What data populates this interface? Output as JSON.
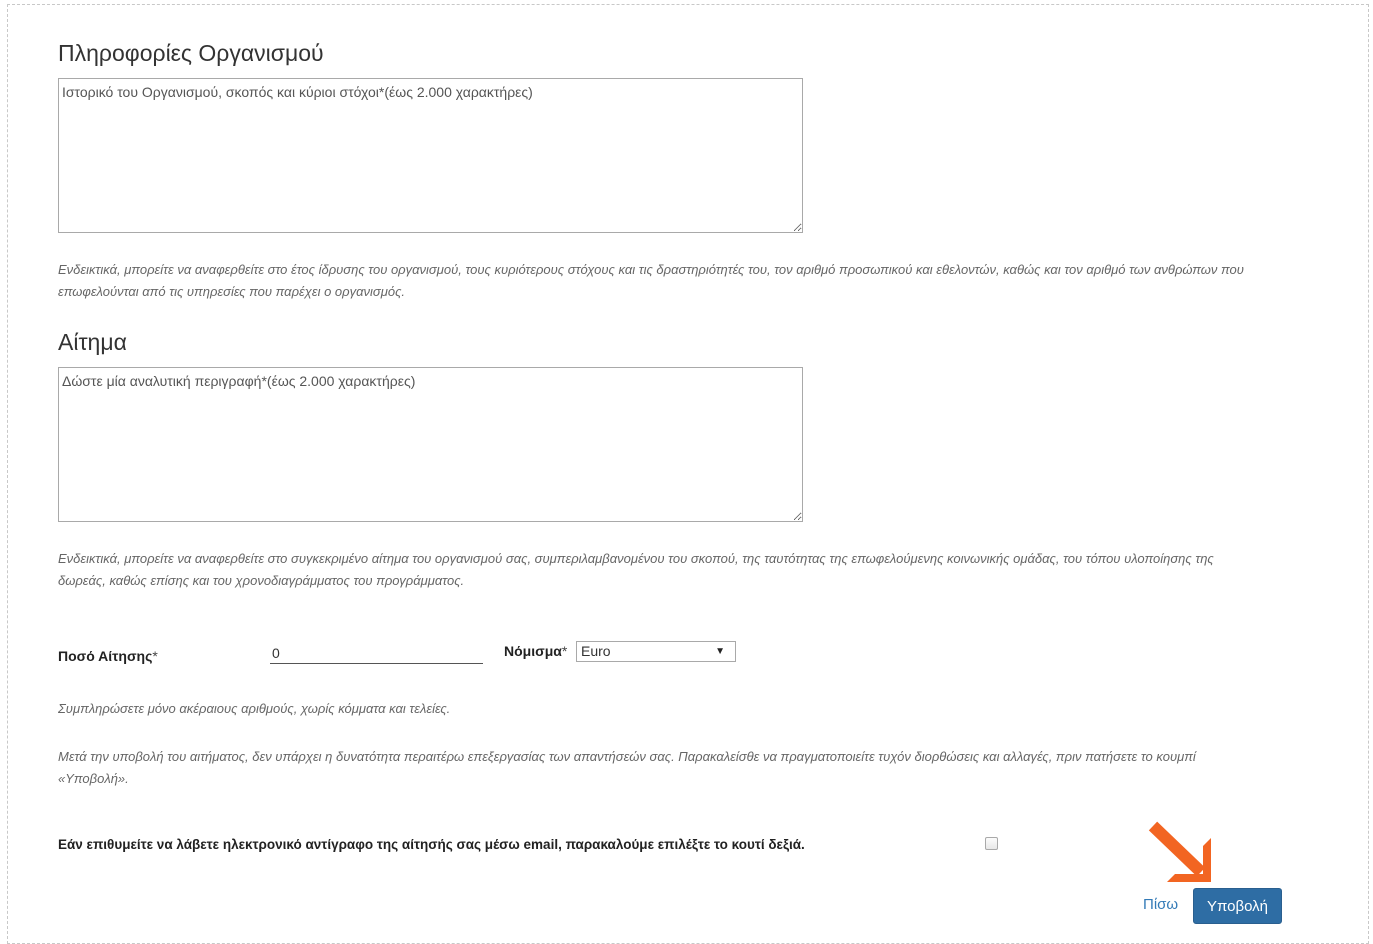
{
  "org_section": {
    "title": "Πληροφορίες Οργανισμού",
    "textarea_placeholder": "Ιστορικό του Οργανισμού, σκοπός και κύριοι στόχοι*(έως 2.000 χαρακτήρες)",
    "hint": "Ενδεικτικά, μπορείτε να αναφερθείτε στο έτος ίδρυσης του οργανισμού, τους κυριότερους στόχους και τις δραστηριότητές του, τον αριθμό προσωπικού και εθελοντών, καθώς και τον αριθμό των ανθρώπων που επωφελούνται από τις υπηρεσίες που παρέχει ο οργανισμός."
  },
  "request_section": {
    "title": "Αίτημα",
    "textarea_placeholder": "Δώστε μία αναλυτική περιγραφή*(έως 2.000 χαρακτήρες)",
    "hint": "Ενδεικτικά, μπορείτε να αναφερθείτε στο συγκεκριμένο αίτημα του οργανισμού σας, συμπεριλαμβανομένου του σκοπού, της ταυτότητας της επωφελούμενης κοινωνικής ομάδας, του τόπου υλοποίησης της δωρεάς, καθώς επίσης και του χρονοδιαγράμματος του προγράμματος."
  },
  "amount": {
    "label": "Ποσό Αίτησης",
    "required_mark": "*",
    "value": "0",
    "currency_label": "Νόμισμα",
    "currency_required_mark": "*",
    "currency_selected": "Euro",
    "hint": "Συμπληρώσετε μόνο ακέραιους αριθμούς, χωρίς κόμματα και τελείες."
  },
  "submit_notice": "Μετά την υποβολή του αιτήματος, δεν υπάρχει η δυνατότητα περαιτέρω επεξεργασίας των απαντήσεών σας. Παρακαλείσθε να πραγματοποιείτε τυχόν διορθώσεις και αλλαγές, πριν πατήσετε το κουμπί «Υποβολή».",
  "email_copy": {
    "label": "Εάν επιθυμείτε να λάβετε ηλεκτρονικό αντίγραφο της αίτησής σας μέσω email, παρακαλούμε επιλέξτε το κουτί δεξιά.",
    "checked": false
  },
  "actions": {
    "back_label": "Πίσω",
    "submit_label": "Υποβολή"
  },
  "colors": {
    "primary": "#2e6da4",
    "link": "#337ab7",
    "annotation_arrow": "#f26522"
  },
  "icons": {
    "select_arrow": "caret-down-icon",
    "annotation": "arrow-down-right-icon"
  }
}
